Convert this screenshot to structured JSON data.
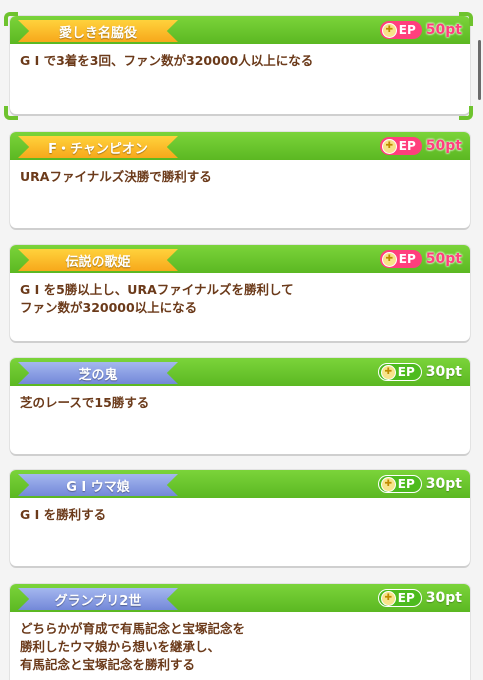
{
  "cards": [
    {
      "title": "愛しき名脇役",
      "ribbon": "gold",
      "ep": "EP",
      "points": "50pt",
      "points_style": "red",
      "description": "G I で3着を3回、ファン数が320000人以上になる"
    },
    {
      "title": "F・チャンピオン",
      "ribbon": "gold",
      "ep": "EP",
      "points": "50pt",
      "points_style": "red",
      "description": "URAファイナルズ決勝で勝利する"
    },
    {
      "title": "伝説の歌姫",
      "ribbon": "gold",
      "ep": "EP",
      "points": "50pt",
      "points_style": "red",
      "description": "G I を5勝以上し、URAファイナルズを勝利して\nファン数が320000以上になる"
    },
    {
      "title": "芝の鬼",
      "ribbon": "blue",
      "ep": "EP",
      "points": "30pt",
      "points_style": "white",
      "description": "芝のレースで15勝する"
    },
    {
      "title": "G I ウマ娘",
      "ribbon": "blue",
      "ep": "EP",
      "points": "30pt",
      "points_style": "white",
      "description": "G I を勝利する"
    },
    {
      "title": "グランプリ2世",
      "ribbon": "blue",
      "ep": "EP",
      "points": "30pt",
      "points_style": "white",
      "description": "どちらかが育成で有馬記念と宝塚記念を\n勝利したウマ娘から想いを継承し、\n有馬記念と宝塚記念を勝利する"
    }
  ]
}
